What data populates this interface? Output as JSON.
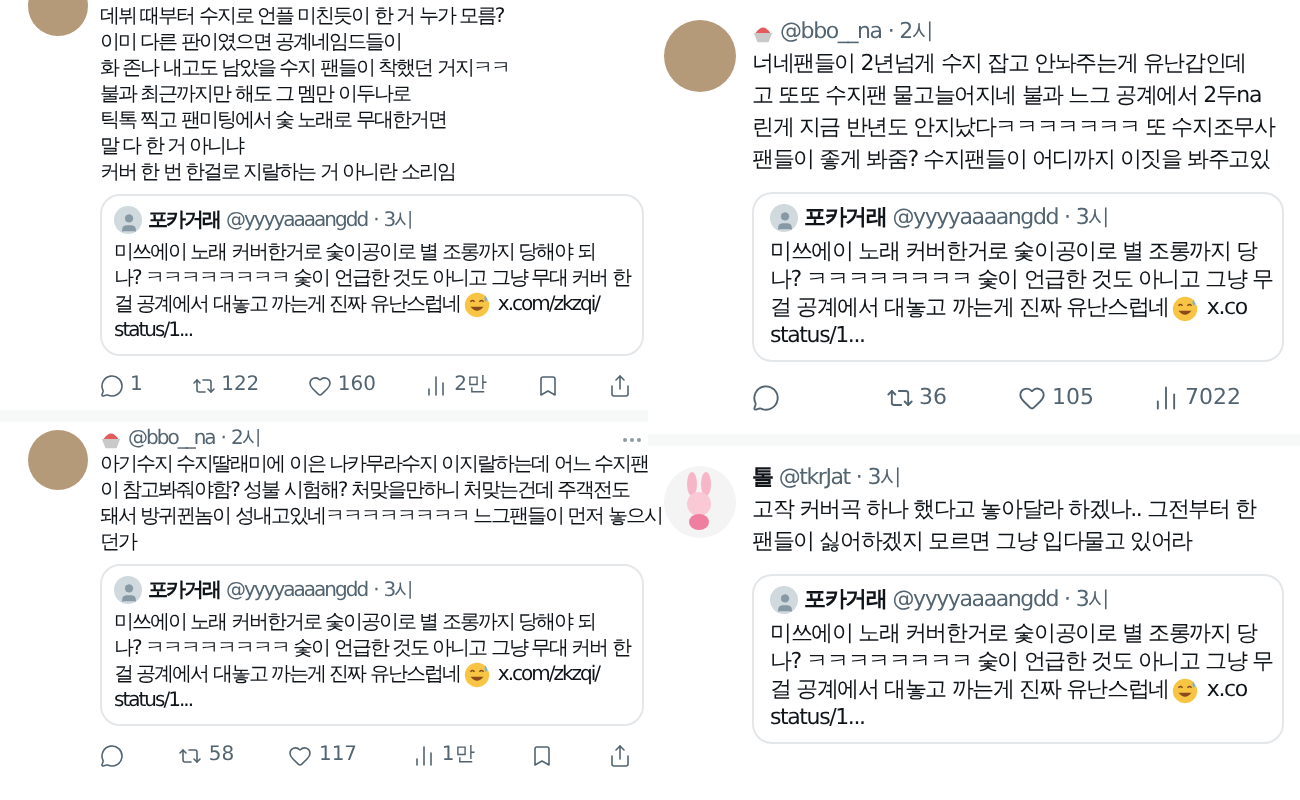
{
  "columns": [
    {
      "tweets": [
        {
          "avatar": {
            "kind": "photo"
          },
          "more": false,
          "lines": [
            "데뷔 때부터 수지로 언플 미친듯이 한 거 누가 모름?",
            "이미 다른 판이였으면 공계네임드들이",
            "화 존나 내고도 남았을 수지 팬들이 착했던 거지ㅋㅋ",
            "불과 최근까지만 해도 그 멤만 이두나로",
            "틱톡 찍고 팬미팅에서 숯 노래로 무대한거면",
            "말 다 한 거 아니냐",
            "커버 한 번 한걸로 지랄하는 거 아니란 소리임"
          ],
          "quote": {
            "name": "포카거래",
            "handle": "@yyyyaaaangdd",
            "separator": "·",
            "time": "3시",
            "lines": [
              {
                "text": "미쓰에이 노래 커버한거로 숯이공이로 별 조롱까지 당해야 되",
                "emoji": false
              },
              {
                "text": "나? ㅋㅋㅋㅋㅋㅋㅋㅋ 숯이 언급한 것도 아니고 그냥 무대 커버 한",
                "emoji": false
              },
              {
                "text": "걸 공계에서 대놓고 까는게 진짜 유난스럽네",
                "emoji": true,
                "tail": "x.com/zkzqi/"
              },
              {
                "text": "status/1...",
                "emoji": false
              }
            ]
          },
          "actions": [
            {
              "kind": "reply",
              "count": "1"
            },
            {
              "kind": "retweet",
              "count": "122"
            },
            {
              "kind": "like",
              "count": "160"
            },
            {
              "kind": "views",
              "count": "2만"
            },
            {
              "kind": "bookmark"
            },
            {
              "kind": "share"
            }
          ]
        },
        {
          "avatar": {
            "kind": "photo"
          },
          "header": {
            "emoji_icon": true,
            "handle": "@bbo__na",
            "separator": "·",
            "time": "2시"
          },
          "more": true,
          "lines": [
            "아기수지 수지딸래미에 이은 나카무라수지 이지랄하는데 어느 수지팬",
            "이 참고봐줘야함? 성불 시험해? 처맞을만하니 처맞는건데 주객전도",
            "돼서 방귀뀐놈이 성내고있네ㅋㅋㅋㅋㅋㅋㅋㅋ 느그팬들이 먼저 놓으시",
            "던가"
          ],
          "quote": {
            "name": "포카거래",
            "handle": "@yyyyaaaangdd",
            "separator": "·",
            "time": "3시",
            "lines": [
              {
                "text": "미쓰에이 노래 커버한거로 숯이공이로 별 조롱까지 당해야 되",
                "emoji": false
              },
              {
                "text": "나? ㅋㅋㅋㅋㅋㅋㅋㅋ 숯이 언급한 것도 아니고 그냥 무대 커버 한",
                "emoji": false
              },
              {
                "text": "걸 공계에서 대놓고 까는게 진짜 유난스럽네",
                "emoji": true,
                "tail": "x.com/zkzqi/"
              },
              {
                "text": "status/1...",
                "emoji": false
              }
            ]
          },
          "actions": [
            {
              "kind": "reply"
            },
            {
              "kind": "retweet",
              "count": "58"
            },
            {
              "kind": "like",
              "count": "117"
            },
            {
              "kind": "views",
              "count": "1만"
            },
            {
              "kind": "bookmark"
            },
            {
              "kind": "share"
            }
          ]
        }
      ]
    },
    {
      "tweets": [
        {
          "avatar": {
            "kind": "photo"
          },
          "header": {
            "emoji_icon": true,
            "handle": "@bbo__na",
            "separator": "·",
            "time": "2시"
          },
          "more": false,
          "lines": [
            "너네팬들이 2년넘게 수지 잡고 안놔주는게 유난갑인데",
            "고 또또 수지팬 물고늘어지네 불과 느그 공계에서 2두na",
            "린게 지금 반년도 안지났다ㅋㅋㅋㅋㅋㅋㅋ 또 수지조무사",
            "팬들이 좋게 봐줌? 수지팬들이 어디까지 이짓을 봐주고있"
          ],
          "quote": {
            "name": "포카거래",
            "handle": "@yyyyaaaangdd",
            "separator": "·",
            "time": "3시",
            "lines": [
              {
                "text": "미쓰에이 노래 커버한거로 숯이공이로 별 조롱까지 당",
                "emoji": false
              },
              {
                "text": "나? ㅋㅋㅋㅋㅋㅋㅋㅋ 숯이 언급한 것도 아니고 그냥 무",
                "emoji": false
              },
              {
                "text": "걸 공계에서 대놓고 까는게 진짜 유난스럽네",
                "emoji": true,
                "tail": "x.co"
              },
              {
                "text": "status/1...",
                "emoji": false
              }
            ]
          },
          "actions": [
            {
              "kind": "reply"
            },
            {
              "kind": "retweet",
              "count": "36"
            },
            {
              "kind": "like",
              "count": "105"
            },
            {
              "kind": "views",
              "count": "7022"
            }
          ]
        },
        {
          "avatar": {
            "kind": "illustration"
          },
          "header": {
            "emoji_icon": false,
            "name": "톨",
            "handle": "@tkrJat",
            "separator": "·",
            "time": "3시"
          },
          "more": false,
          "lines": [
            "고작 커버곡 하나 했다고 놓아달라 하겠나.. 그전부터 한",
            "팬들이 싫어하겠지 모르면 그냥 입다물고 있어라"
          ],
          "quote": {
            "name": "포카거래",
            "handle": "@yyyyaaaangdd",
            "separator": "·",
            "time": "3시",
            "lines": [
              {
                "text": "미쓰에이 노래 커버한거로 숯이공이로 별 조롱까지 당",
                "emoji": false
              },
              {
                "text": "나? ㅋㅋㅋㅋㅋㅋㅋㅋ 숯이 언급한 것도 아니고 그냥 무",
                "emoji": false
              },
              {
                "text": "걸 공계에서 대놓고 까는게 진짜 유난스럽네",
                "emoji": true,
                "tail": "x.co"
              },
              {
                "text": "status/1...",
                "emoji": false
              }
            ]
          }
        }
      ]
    }
  ]
}
